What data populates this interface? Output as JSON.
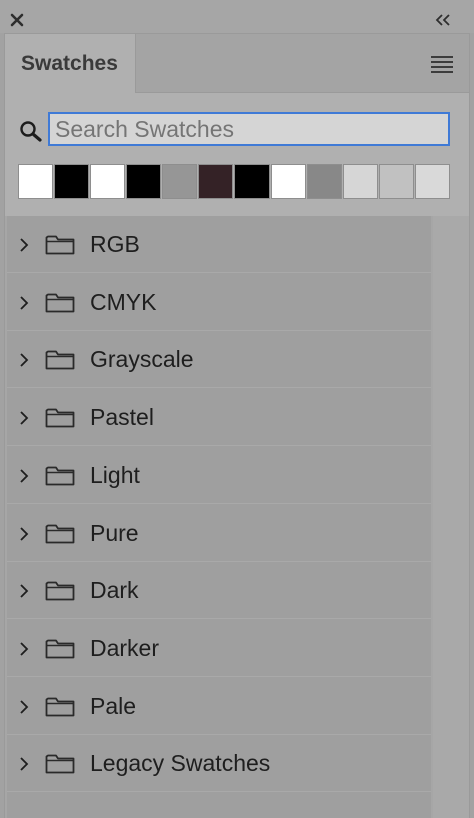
{
  "panel": {
    "tab_label": "Swatches",
    "search": {
      "placeholder": "Search Swatches",
      "value": ""
    },
    "swatches": [
      {
        "color": "#ffffff"
      },
      {
        "color": "#000000"
      },
      {
        "color": "#ffffff"
      },
      {
        "color": "#000000"
      },
      {
        "color": "#969696"
      },
      {
        "color": "#342226"
      },
      {
        "color": "#000000"
      },
      {
        "color": "#ffffff"
      },
      {
        "color": "#888888"
      },
      {
        "color": "#d6d6d6"
      },
      {
        "color": "#c1c1c1"
      },
      {
        "color": "#d9d9d9"
      }
    ],
    "folders": [
      {
        "label": "RGB"
      },
      {
        "label": "CMYK"
      },
      {
        "label": "Grayscale"
      },
      {
        "label": "Pastel"
      },
      {
        "label": "Light"
      },
      {
        "label": "Pure"
      },
      {
        "label": "Dark"
      },
      {
        "label": "Darker"
      },
      {
        "label": "Pale"
      },
      {
        "label": "Legacy Swatches"
      }
    ]
  },
  "icons": {
    "close": "close-icon",
    "collapse": "double-chevron-left-icon",
    "menu": "hamburger-menu-icon",
    "search": "magnifier-icon",
    "expand": "chevron-right-icon",
    "folder": "folder-icon"
  },
  "colors": {
    "accent": "#3f7ad6",
    "panel_bg": "#b0b0b0",
    "list_bg": "#9f9f9f"
  }
}
